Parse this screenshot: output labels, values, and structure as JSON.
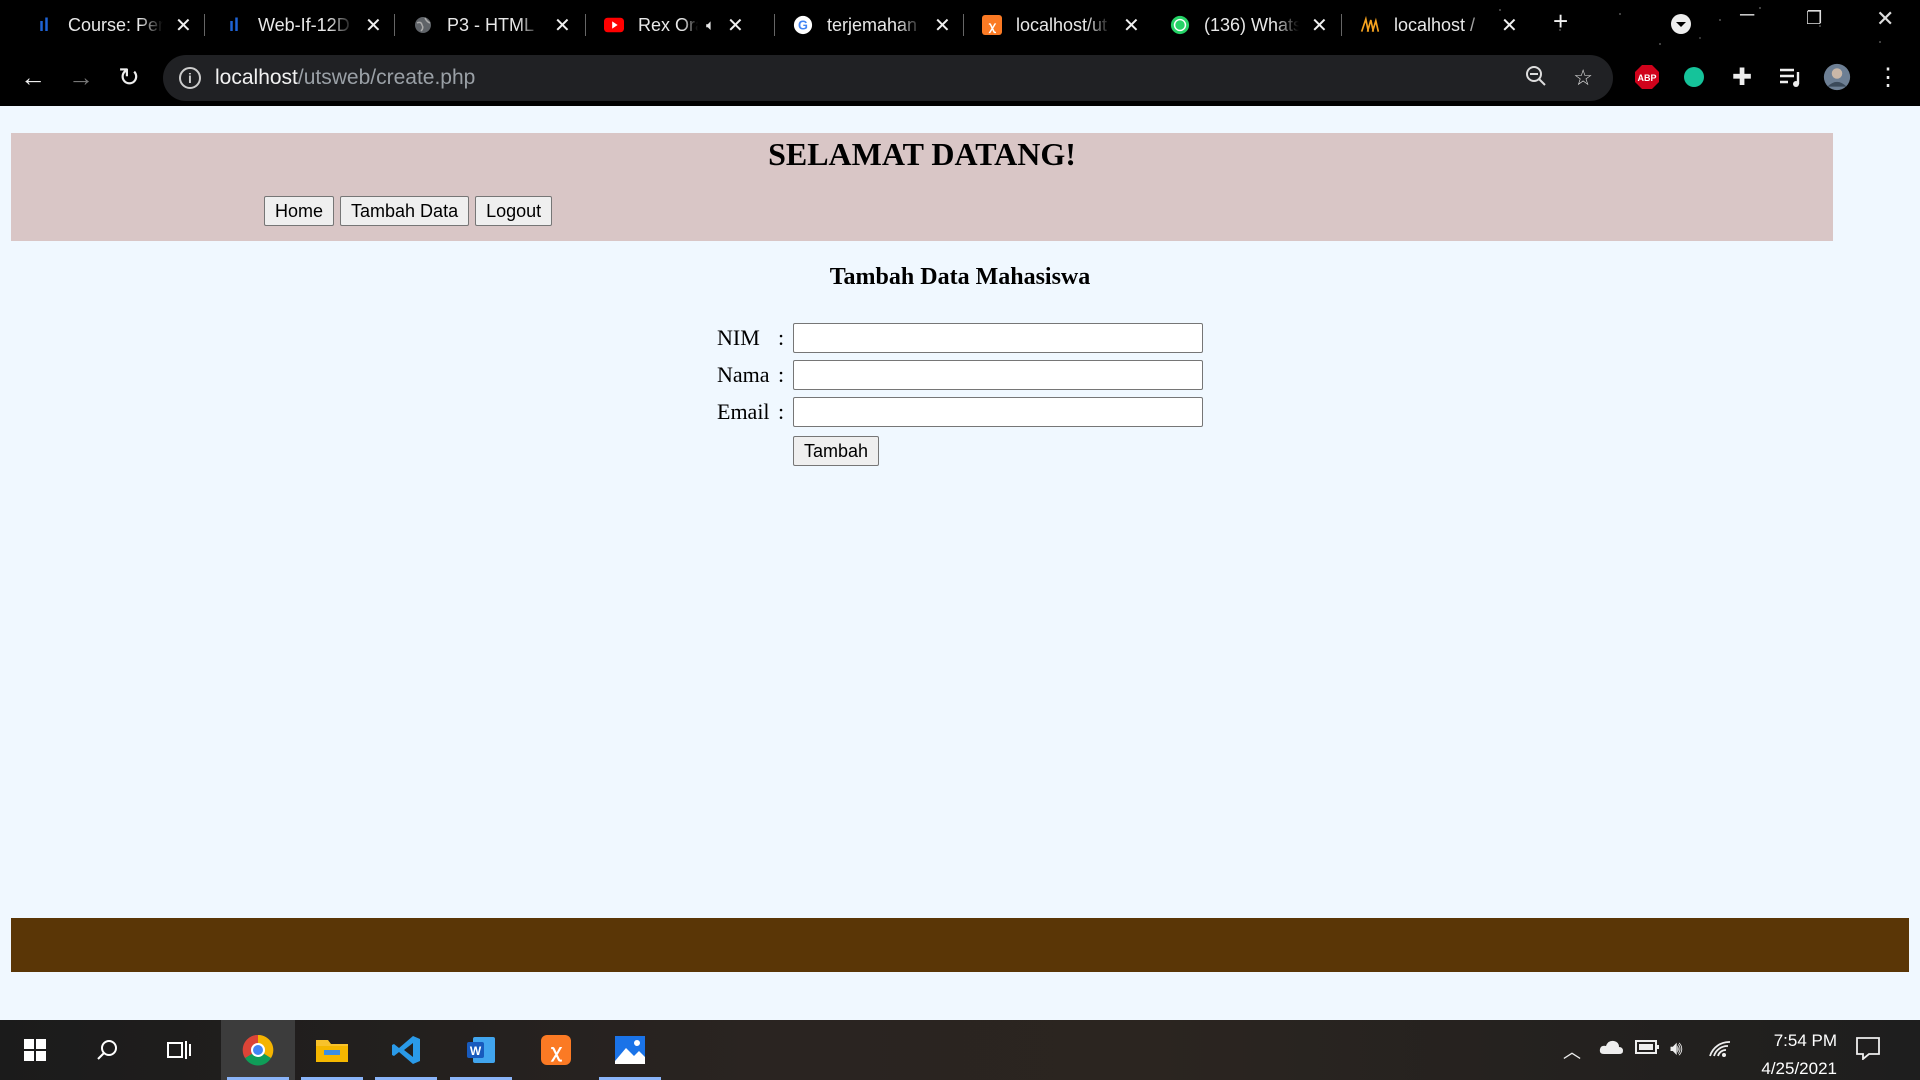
{
  "browser": {
    "tabs": [
      {
        "title": "Course: Pen",
        "icon": "moodle-icon",
        "color": "#1e63d6"
      },
      {
        "title": "Web-If-12D",
        "icon": "moodle-icon",
        "color": "#1e63d6"
      },
      {
        "title": "P3 - HTML",
        "icon": "globe-icon",
        "color": "#9aa0a6"
      },
      {
        "title": "Rex Ora",
        "icon": "youtube-icon",
        "color": "#ff0000",
        "audio": true
      },
      {
        "title": "terjemahan",
        "icon": "google-icon",
        "color": "#ffffff"
      },
      {
        "title": "localhost/ut",
        "icon": "xampp-icon",
        "color": "#fb7a24"
      },
      {
        "title": "(136) Whats",
        "icon": "whatsapp-icon",
        "color": "#25d366"
      },
      {
        "title": "localhost /",
        "icon": "phpmyadmin-icon",
        "color": "#f6a21e"
      }
    ],
    "new_tab": "+",
    "url_host": "localhost",
    "url_path": "/utsweb/create.php"
  },
  "page": {
    "heading": "SELAMAT DATANG!",
    "nav": {
      "home": "Home",
      "add": "Tambah Data",
      "logout": "Logout"
    },
    "form_title": "Tambah Data Mahasiswa",
    "fields": {
      "nim_label": "NIM",
      "nama_label": "Nama",
      "email_label": "Email",
      "colon": ":",
      "nim_value": "",
      "nama_value": "",
      "email_value": ""
    },
    "submit_label": "Tambah"
  },
  "taskbar": {
    "time": "7:54 PM",
    "date": "4/25/2021"
  }
}
